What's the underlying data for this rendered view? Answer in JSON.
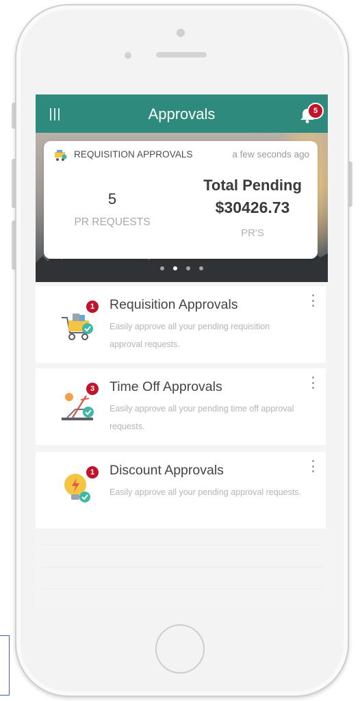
{
  "header": {
    "title": "Approvals",
    "notification_count": "5"
  },
  "summary_card": {
    "type_label": "REQUISITION APPROVALS",
    "timestamp": "a few seconds ago",
    "pr_count": "5",
    "pr_count_label": "PR REQUESTS",
    "total_title": "Total Pending",
    "total_amount": "$30426.73",
    "total_label": "PR'S",
    "carousel_pages": 4,
    "carousel_active_page": 2
  },
  "approvals": [
    {
      "title": "Requisition Approvals",
      "description": "Easily approve all your pending requisition approval requests.",
      "badge": "1",
      "icon": "shopping-cart-icon"
    },
    {
      "title": "Time Off Approvals",
      "description": "Easily approve all your pending time off approval requests.",
      "badge": "3",
      "icon": "sun-lounger-icon"
    },
    {
      "title": "Discount Approvals",
      "description": "Easily approve all your pending approval requests.",
      "badge": "1",
      "icon": "lightbulb-icon"
    }
  ],
  "colors": {
    "header_bg": "#2e8a7c",
    "badge": "#c0142c",
    "check_teal": "#3fb8a4"
  }
}
